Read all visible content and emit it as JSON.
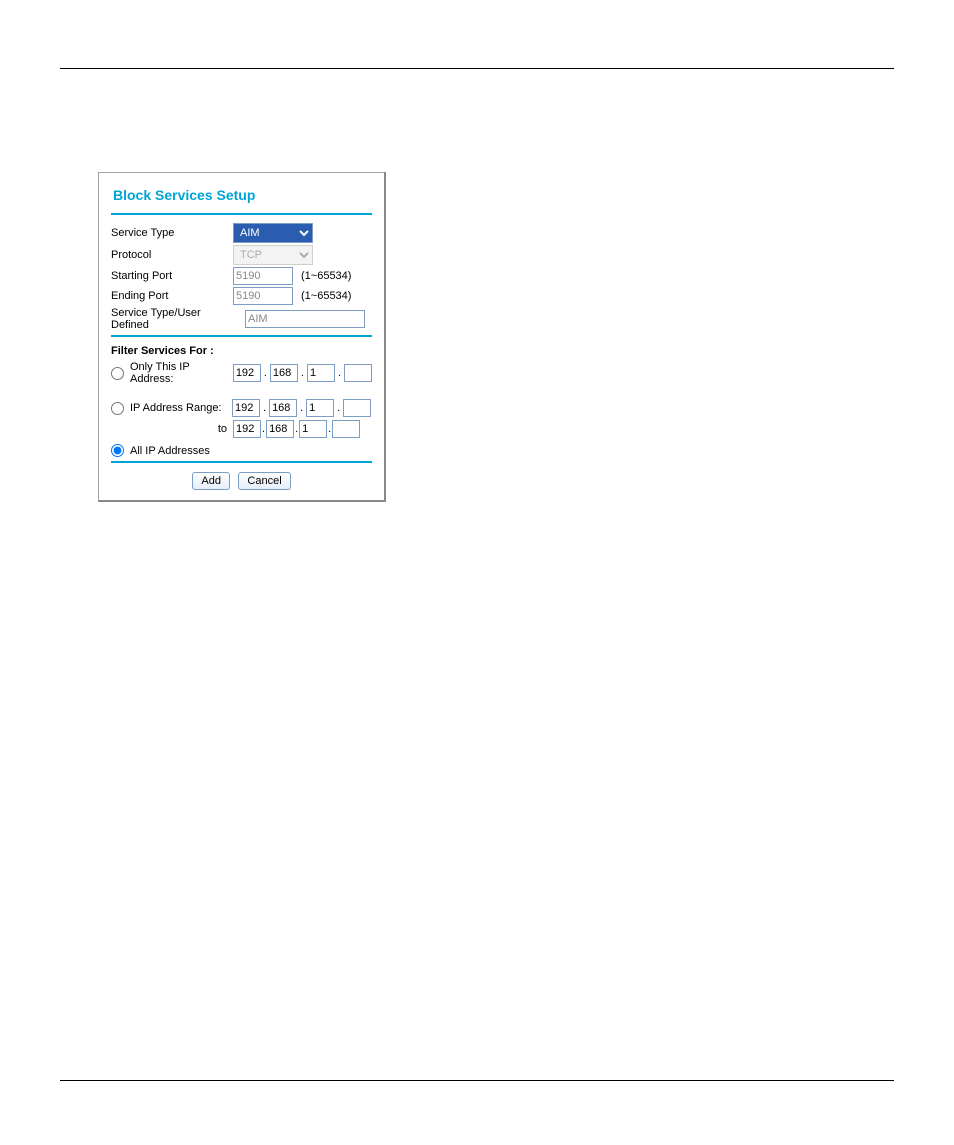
{
  "panel": {
    "title": "Block Services Setup",
    "fields": {
      "service_type_label": "Service Type",
      "service_type_value": "AIM",
      "protocol_label": "Protocol",
      "protocol_value": "TCP",
      "starting_port_label": "Starting Port",
      "starting_port_value": "5190",
      "ending_port_label": "Ending Port",
      "ending_port_value": "5190",
      "port_hint": "(1~65534)",
      "user_defined_label": "Service Type/User Defined",
      "user_defined_value": "AIM"
    },
    "filter": {
      "heading": "Filter Services For :",
      "only_label": "Only This IP Address:",
      "only_ip": [
        "192",
        "168",
        "1",
        ""
      ],
      "range_label": "IP Address Range:",
      "range_from": [
        "192",
        "168",
        "1",
        ""
      ],
      "range_to_label": "to",
      "range_to": [
        "192",
        "168",
        "1",
        ""
      ],
      "all_label": "All IP Addresses",
      "selected": "all"
    },
    "buttons": {
      "add": "Add",
      "cancel": "Cancel"
    }
  }
}
